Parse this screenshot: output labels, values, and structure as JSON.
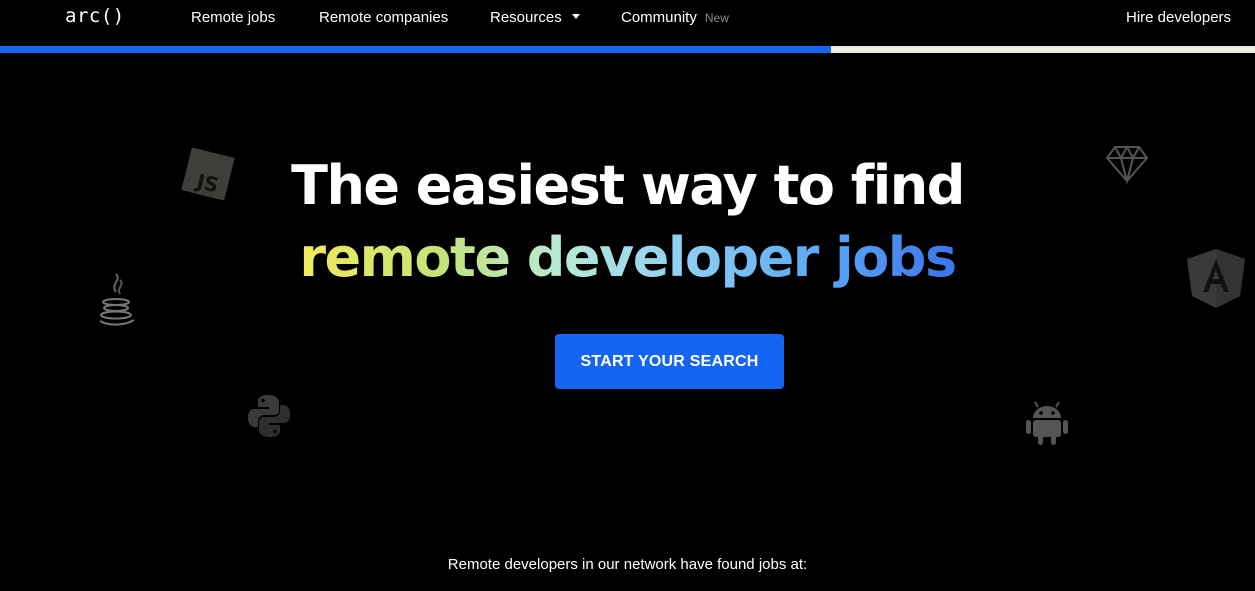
{
  "nav": {
    "logo": "arc()",
    "items": [
      {
        "label": "Remote jobs"
      },
      {
        "label": "Remote companies"
      },
      {
        "label": "Resources"
      },
      {
        "label": "Community",
        "badge": "New"
      }
    ],
    "hire_label": "Hire developers"
  },
  "progress": {
    "fraction": 0.662
  },
  "hero": {
    "line1": "The easiest way to find",
    "line2": "remote developer jobs",
    "cta_label": "START YOUR SEARCH"
  },
  "footnote": "Remote developers in our network have found jobs at:",
  "icons": [
    "javascript-icon",
    "java-icon",
    "python-icon",
    "sketch-icon",
    "angular-icon",
    "android-icon"
  ],
  "colors": {
    "background": "#000000",
    "accent": "#1565f5",
    "gradient": [
      "#f2ea5c",
      "#c3e47a",
      "#b7ead7",
      "#8fd0f3",
      "#5aa6f5",
      "#3b74ea"
    ]
  }
}
